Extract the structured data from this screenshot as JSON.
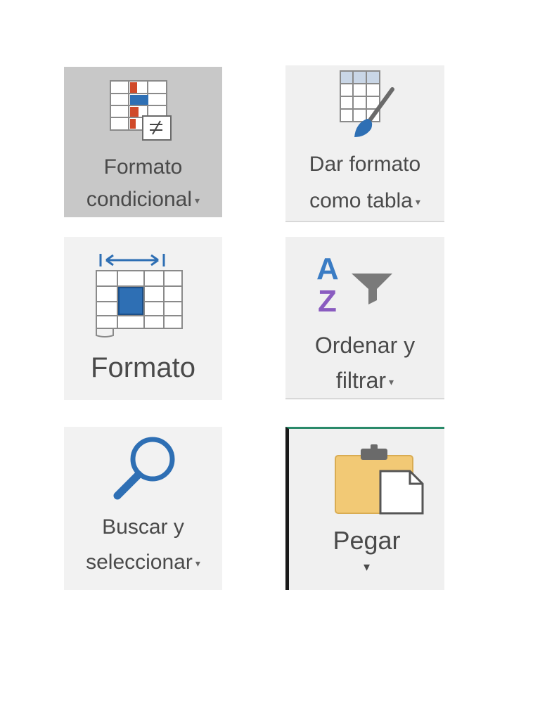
{
  "ribbon_buttons": {
    "conditional_format": {
      "line1": "Formato",
      "line2": "condicional",
      "caret": "▾",
      "icon": "conditional-format-icon",
      "selected": true
    },
    "format_as_table": {
      "line1": "Dar formato",
      "line2": "como tabla",
      "caret": "▾",
      "icon": "format-as-table-icon"
    },
    "format": {
      "line1": "Formato",
      "icon": "cell-format-icon"
    },
    "sort_filter": {
      "line1": "Ordenar y",
      "line2": "filtrar",
      "caret": "▾",
      "icon": "sort-filter-icon",
      "icon_letters": [
        "A",
        "Z"
      ]
    },
    "find_select": {
      "line1": "Buscar y",
      "line2": "seleccionar",
      "caret": "▾",
      "icon": "magnifier-icon"
    },
    "paste": {
      "line1": "Pegar",
      "caret": "▾",
      "icon": "clipboard-paste-icon"
    }
  },
  "colors": {
    "selected_bg": "#c8c8c8",
    "tile_bg": "#f0f0f0",
    "icon_blue": "#2e6fb4",
    "icon_red": "#d04a2a",
    "sort_blue": "#3a7cc4",
    "sort_purple": "#8a5cc0",
    "clipboard": "#f2c975"
  }
}
